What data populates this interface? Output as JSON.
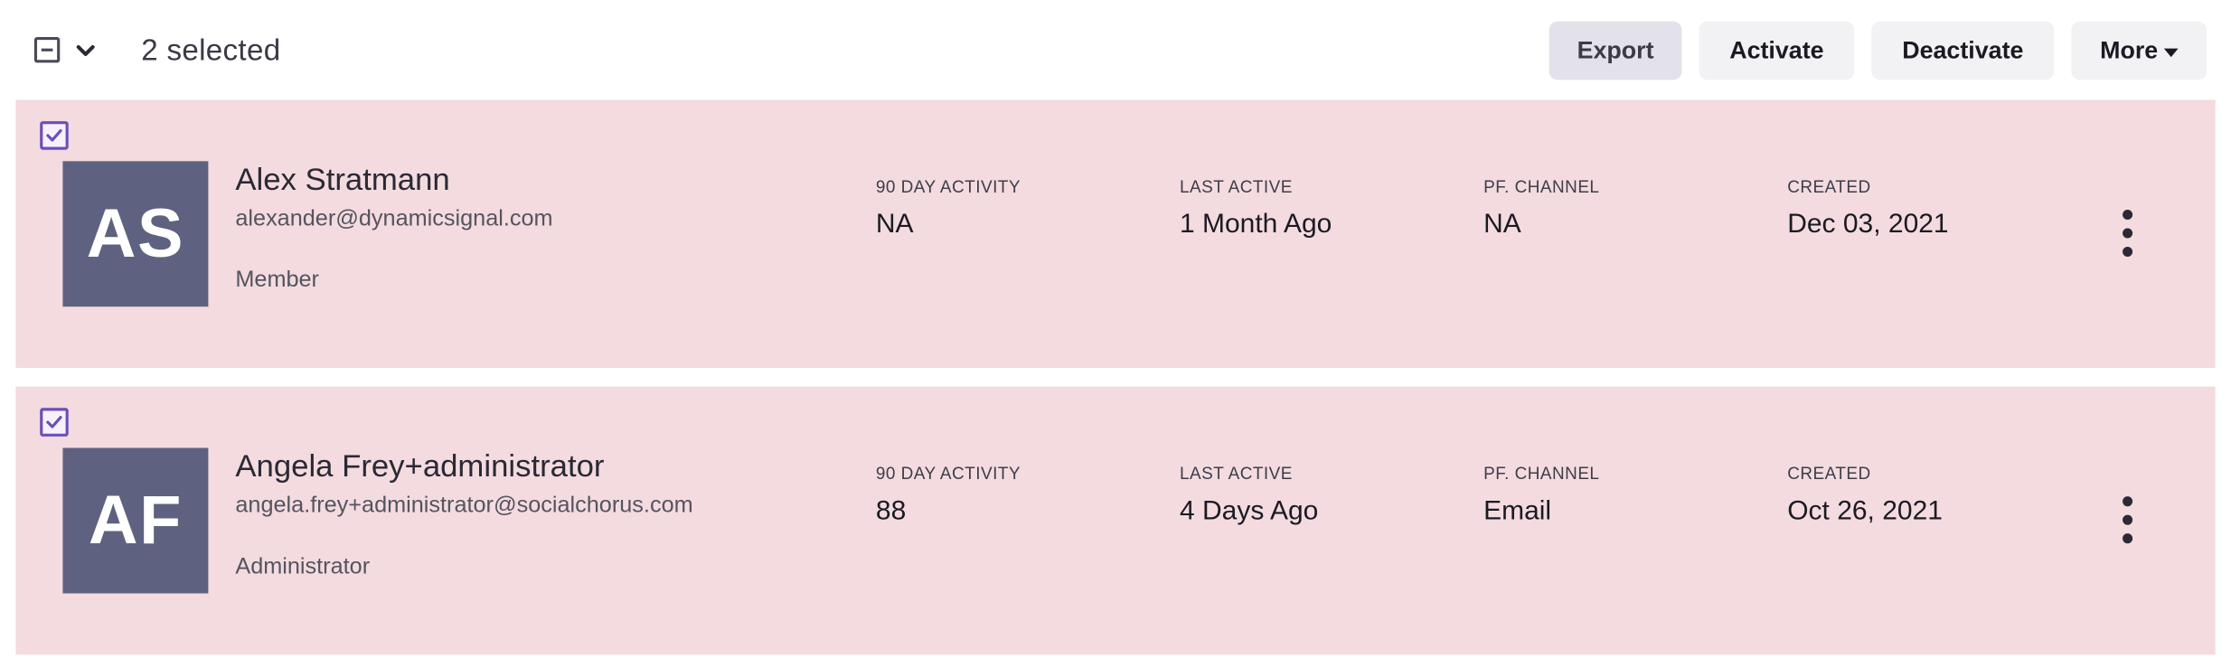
{
  "toolbar": {
    "selected_count": "2 selected",
    "export_label": "Export",
    "activate_label": "Activate",
    "deactivate_label": "Deactivate",
    "more_label": "More"
  },
  "columns": {
    "activity": "90 DAY ACTIVITY",
    "last_active": "LAST ACTIVE",
    "channel": "PF. CHANNEL",
    "created": "CREATED"
  },
  "users": [
    {
      "initials": "AS",
      "name": "Alex Stratmann",
      "email": "alexander@dynamicsignal.com",
      "role": "Member",
      "activity": "NA",
      "last_active": "1 Month Ago",
      "channel": "NA",
      "created": "Dec 03, 2021",
      "selected": true
    },
    {
      "initials": "AF",
      "name": "Angela Frey+administrator",
      "email": "angela.frey+administrator@socialchorus.com",
      "role": "Administrator",
      "activity": "88",
      "last_active": "4 Days Ago",
      "channel": "Email",
      "created": "Oct 26, 2021",
      "selected": true
    }
  ],
  "colors": {
    "row_selected_bg": "#f3dbe0",
    "avatar_bg": "#5e6280",
    "checkbox_accent": "#6b4fbb",
    "button_bg": "#f2f2f4"
  },
  "icons": {
    "bulk_select": "indeterminate-checkbox-icon",
    "bulk_menu": "chevron-down-icon",
    "row_checkbox": "checked-checkbox-icon",
    "row_menu": "kebab-menu-icon",
    "more_caret": "caret-down-icon"
  }
}
